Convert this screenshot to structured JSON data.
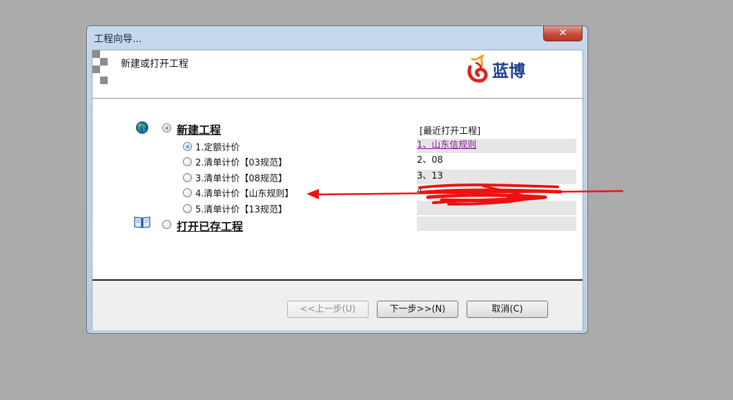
{
  "window": {
    "title": "工程向导...",
    "close_glyph": "✕"
  },
  "header": {
    "title": "新建或打开工程"
  },
  "logo": {
    "text": "蓝博",
    "brand_color": "#1b3f8f",
    "accent_color": "#d7261e"
  },
  "new_project": {
    "label": "新建工程",
    "selected": true,
    "options": [
      {
        "label": "1.定额计价",
        "selected": true
      },
      {
        "label": "2.清单计价【03规范】",
        "selected": false
      },
      {
        "label": "3.清单计价【08规范】",
        "selected": false
      },
      {
        "label": "4.清单计价【山东规则】",
        "selected": false
      },
      {
        "label": "5.清单计价【13规范】",
        "selected": false
      }
    ]
  },
  "open_project": {
    "label": "打开已存工程",
    "selected": false
  },
  "recent": {
    "title": "[最近打开工程]",
    "items": [
      {
        "label": "1、山东信规则"
      },
      {
        "label": "2、08"
      },
      {
        "label": "3、13"
      },
      {
        "label": "4、"
      },
      {
        "label": ""
      },
      {
        "label": ""
      }
    ]
  },
  "buttons": {
    "prev": "<<上一步(U)",
    "next": "下一步>>(N)",
    "cancel": "取消(C)"
  },
  "annotation": {
    "color": "#ee1111"
  }
}
